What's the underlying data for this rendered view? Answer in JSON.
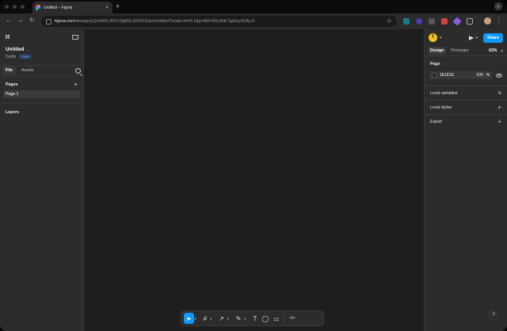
{
  "browser": {
    "tab_title": "Untitled – Figma",
    "tab_close": "×",
    "new_tab": "+",
    "tab_menu": "⌄",
    "url_host": "figma.com",
    "url_path": "/design/yQUieRnJ5VC3gM2LAOCHZpc/Untitled?node-id=0-1&p=f&t=StLHhK7jpEky3ZAy-0",
    "nav_back": "←",
    "nav_forward": "→",
    "nav_reload": "↻",
    "star": "☆",
    "menu": "⋮"
  },
  "left_panel": {
    "menu_icon": "⌘",
    "file_name": "Untitled",
    "file_caret": "⌄",
    "location": "Drafts",
    "plan_badge": "Free",
    "tabs": [
      {
        "label": "File"
      },
      {
        "label": "Assets"
      }
    ],
    "pages_title": "Pages",
    "add_page": "+",
    "pages": [
      {
        "label": "Page 1"
      }
    ],
    "layers_title": "Layers"
  },
  "right_panel": {
    "user_initial": "T",
    "share_label": "Share",
    "tabs": [
      {
        "label": "Design"
      },
      {
        "label": "Prototype"
      }
    ],
    "zoom": "63%",
    "page_section": "Page",
    "fill_hex": "1E1E1E",
    "fill_opacity": "100",
    "fill_unit": "%",
    "rows": [
      {
        "label": "Local variables",
        "action": "⇅"
      },
      {
        "label": "Local styles",
        "action": "+"
      },
      {
        "label": "Export",
        "action": "+"
      }
    ]
  },
  "toolbar": {
    "tools": [
      {
        "name": "move",
        "glyph": "➤"
      },
      {
        "name": "frame",
        "glyph": "#"
      },
      {
        "name": "shape",
        "glyph": "↗"
      },
      {
        "name": "pen",
        "glyph": "✎"
      },
      {
        "name": "text",
        "glyph": "T"
      },
      {
        "name": "comment",
        "glyph": "◯"
      },
      {
        "name": "actions",
        "glyph": "⚏"
      },
      {
        "name": "dev-mode",
        "glyph": "</>"
      }
    ]
  },
  "help_label": "?",
  "colors": {
    "accent": "#0d99ff",
    "canvas": "#1e1e1e",
    "panel": "#2c2c2c",
    "avatar": "#f4c11d"
  }
}
